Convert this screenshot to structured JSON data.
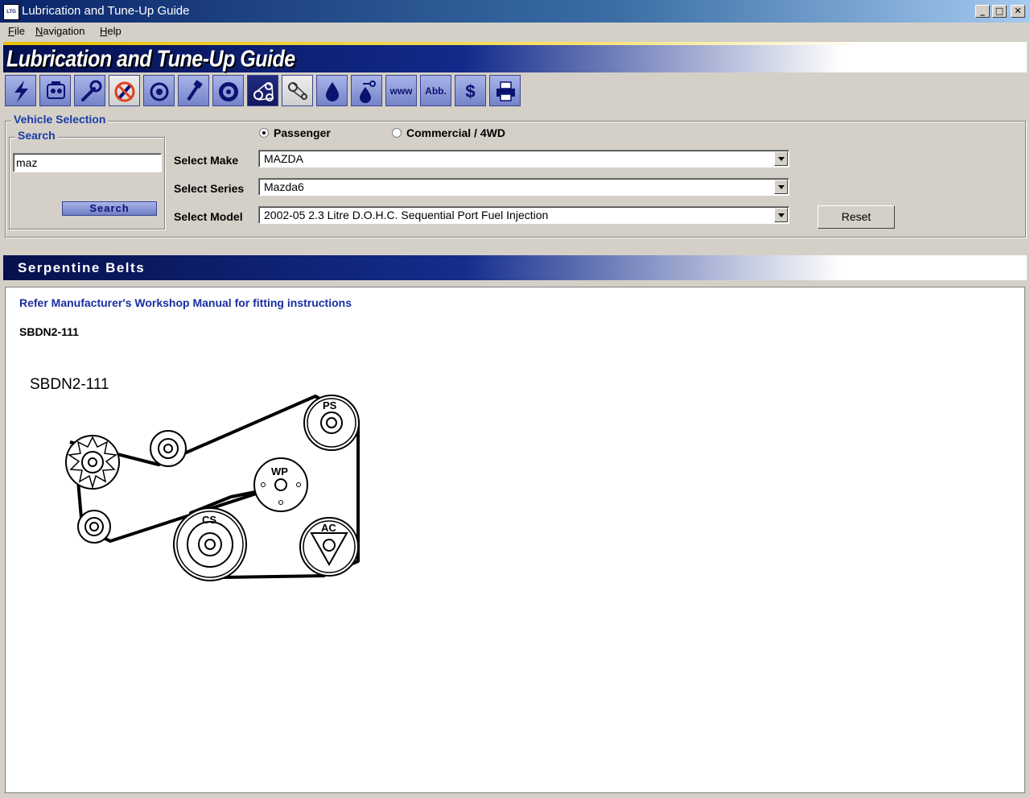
{
  "window": {
    "app_icon_text": "LTG",
    "title": "Lubrication and Tune-Up Guide",
    "minimize_glyph": "_",
    "maximize_glyph": "□",
    "close_glyph": "✕"
  },
  "menu": {
    "file": "File",
    "navigation": "Navigation",
    "help": "Help"
  },
  "banner": {
    "title": "Lubrication and Tune-Up Guide"
  },
  "toolbar": {
    "buttons": [
      {
        "icon": "lightning-icon"
      },
      {
        "icon": "engine-icon"
      },
      {
        "icon": "wrench-icon"
      },
      {
        "icon": "no-spark-icon"
      },
      {
        "icon": "motor-icon"
      },
      {
        "icon": "bolt-icon"
      },
      {
        "icon": "wheel-icon"
      },
      {
        "icon": "belt-icon",
        "active": true
      },
      {
        "icon": "timing-belt-icon"
      },
      {
        "icon": "oil-drop-icon"
      },
      {
        "icon": "oil-key-icon"
      },
      {
        "label": "www"
      },
      {
        "label": "Abb."
      },
      {
        "label": "$"
      },
      {
        "icon": "printer-icon"
      }
    ]
  },
  "vehicle_selection": {
    "legend": "Vehicle Selection",
    "search": {
      "legend": "Search",
      "value": "maz",
      "button": "Search"
    },
    "vehicle_type": {
      "passenger": "Passenger",
      "commercial": "Commercial / 4WD",
      "selected": "Passenger"
    },
    "make": {
      "label": "Select Make",
      "value": "MAZDA"
    },
    "series": {
      "label": "Select Series",
      "value": "Mazda6"
    },
    "model": {
      "label": "Select Model",
      "value": "2002-05 2.3 Litre D.O.H.C. Sequential Port Fuel Injection"
    },
    "reset": "Reset"
  },
  "section": {
    "title": "Serpentine Belts"
  },
  "content": {
    "instruction": "Refer Manufacturer's Workshop Manual for fitting instructions",
    "belt_code": "SBDN2-111",
    "diagram": {
      "title": "SBDN2-111",
      "labels": {
        "ps": "PS",
        "wp": "WP",
        "cs": "CS",
        "ac": "AC"
      }
    }
  }
}
